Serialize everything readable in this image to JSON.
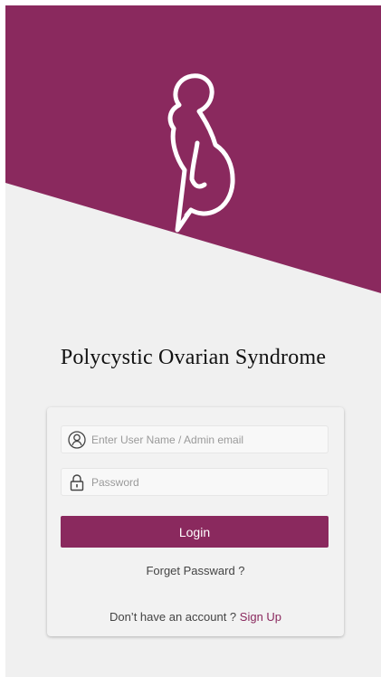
{
  "colors": {
    "brand": "#8a295e",
    "background": "#f0f0f0",
    "card": "#f2f2f2"
  },
  "hero": {
    "illustration": "pregnant-woman-outline-icon"
  },
  "app_title": "Polycystic Ovarian Syndrome",
  "login_form": {
    "username": {
      "icon": "user-circle-icon",
      "placeholder": "Enter User Name / Admin email",
      "value": ""
    },
    "password": {
      "icon": "lock-icon",
      "placeholder": "Password",
      "value": ""
    },
    "login_label": "Login",
    "forget_label": "Forget Passward ?",
    "signup_prompt": "Don’t have an account ? ",
    "signup_label": "Sign Up"
  }
}
